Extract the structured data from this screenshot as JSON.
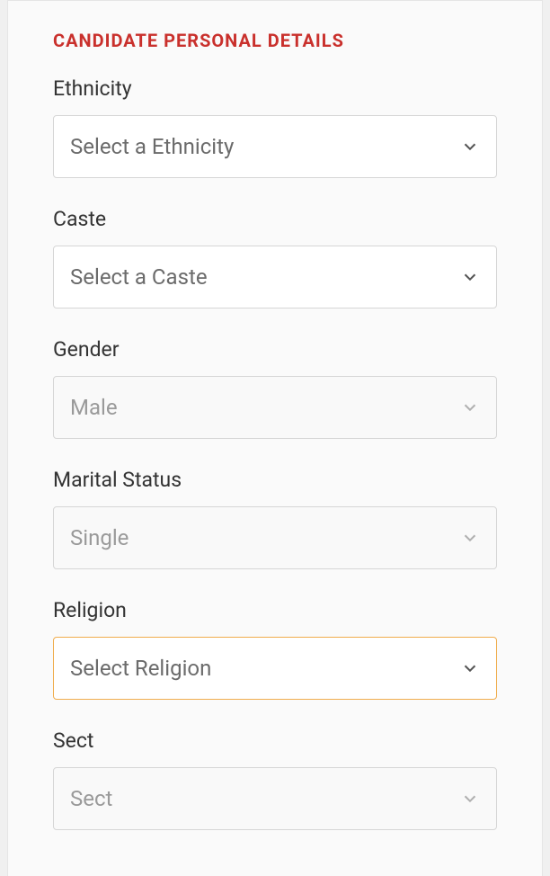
{
  "section": {
    "title": "CANDIDATE PERSONAL DETAILS"
  },
  "fields": {
    "ethnicity": {
      "label": "Ethnicity",
      "value": "Select a Ethnicity"
    },
    "caste": {
      "label": "Caste",
      "value": "Select a Caste"
    },
    "gender": {
      "label": "Gender",
      "value": "Male"
    },
    "marital_status": {
      "label": "Marital Status",
      "value": "Single"
    },
    "religion": {
      "label": "Religion",
      "value": "Select Religion"
    },
    "sect": {
      "label": "Sect",
      "value": "Sect"
    }
  }
}
